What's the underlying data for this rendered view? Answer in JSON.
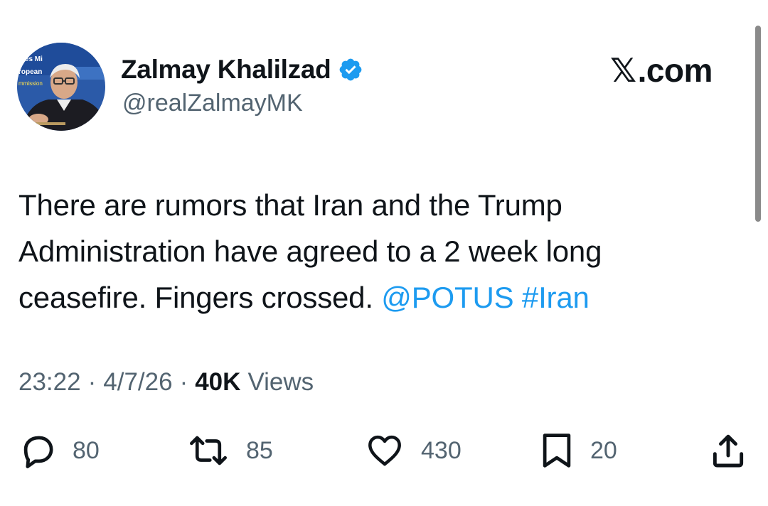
{
  "author": {
    "name": "Zalmay Khalilzad",
    "handle": "@realZalmayMK",
    "verified": true,
    "badge_color": "#1d9bf0",
    "avatar_background_text": [
      "ates Mi",
      "ropean",
      "mmission"
    ]
  },
  "site_label": {
    "x_glyph": "𝕏",
    "text": ".com"
  },
  "tweet": {
    "line1": "There are rumors that Iran and the Trump",
    "line2": "Administration have agreed to a 2 week long",
    "line3_text": "ceasefire. Fingers crossed.",
    "mention": "@POTUS",
    "hashtag": "#Iran",
    "link_color": "#1d9bf0"
  },
  "meta": {
    "time": "23:22",
    "separator": "·",
    "date": "4/7/26",
    "views_count": "40K",
    "views_label": "Views"
  },
  "actions": {
    "replies": "80",
    "reposts": "85",
    "likes": "430",
    "bookmarks": "20",
    "icons": [
      "reply-icon",
      "repost-icon",
      "like-icon",
      "bookmark-icon",
      "share-icon"
    ]
  }
}
